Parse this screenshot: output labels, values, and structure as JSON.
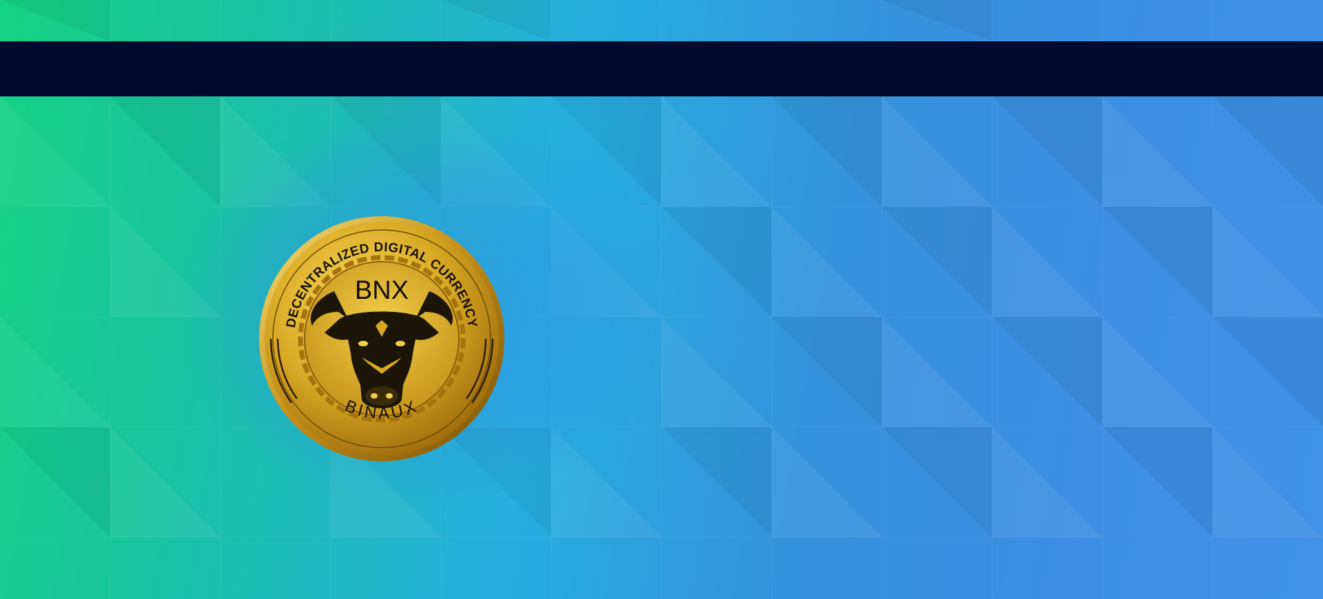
{
  "coin": {
    "arc_text": "DECENTRALIZED DIGITAL CURRENCY",
    "symbol": "BNX",
    "name": "BINAUX",
    "emblem": "bull-head-icon"
  },
  "colors": {
    "bar": "#020a2e",
    "gradient_start": "#14d284",
    "gradient_end": "#3f92e6",
    "gold": "#d9a925",
    "gold_light": "#f4d34a",
    "gold_dark": "#8a5e08"
  }
}
